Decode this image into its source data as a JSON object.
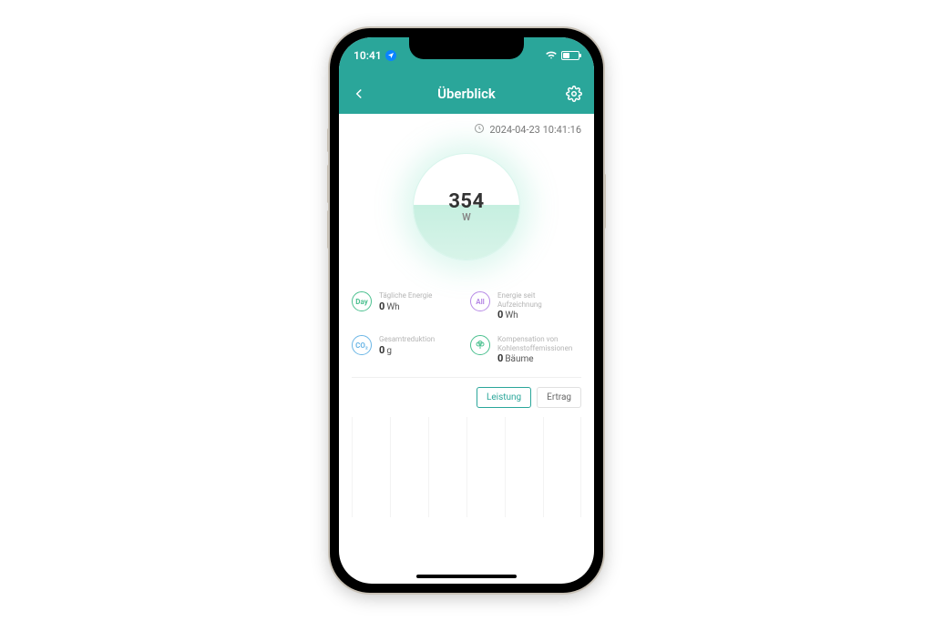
{
  "statusbar": {
    "time": "10:41"
  },
  "header": {
    "title": "Überblick"
  },
  "timestamp": "2024-04-23 10:41:16",
  "gauge": {
    "value": "354",
    "unit": "W"
  },
  "stats": {
    "daily": {
      "label": "Tägliche Energie",
      "value": "0",
      "unit": "Wh",
      "icon_text": "Day"
    },
    "total": {
      "label": "Energie seit Aufzeichnung",
      "value": "0",
      "unit": "Wh",
      "icon_text": "All"
    },
    "co2": {
      "label": "Gesamtreduktion",
      "value": "0",
      "unit": "g",
      "icon_text": "CO₂"
    },
    "trees": {
      "label": "Kompensation von Kohlenstoffemissionen",
      "value": "0",
      "unit": "Bäume"
    }
  },
  "tabs": {
    "leistung": "Leistung",
    "ertrag": "Ertrag"
  }
}
